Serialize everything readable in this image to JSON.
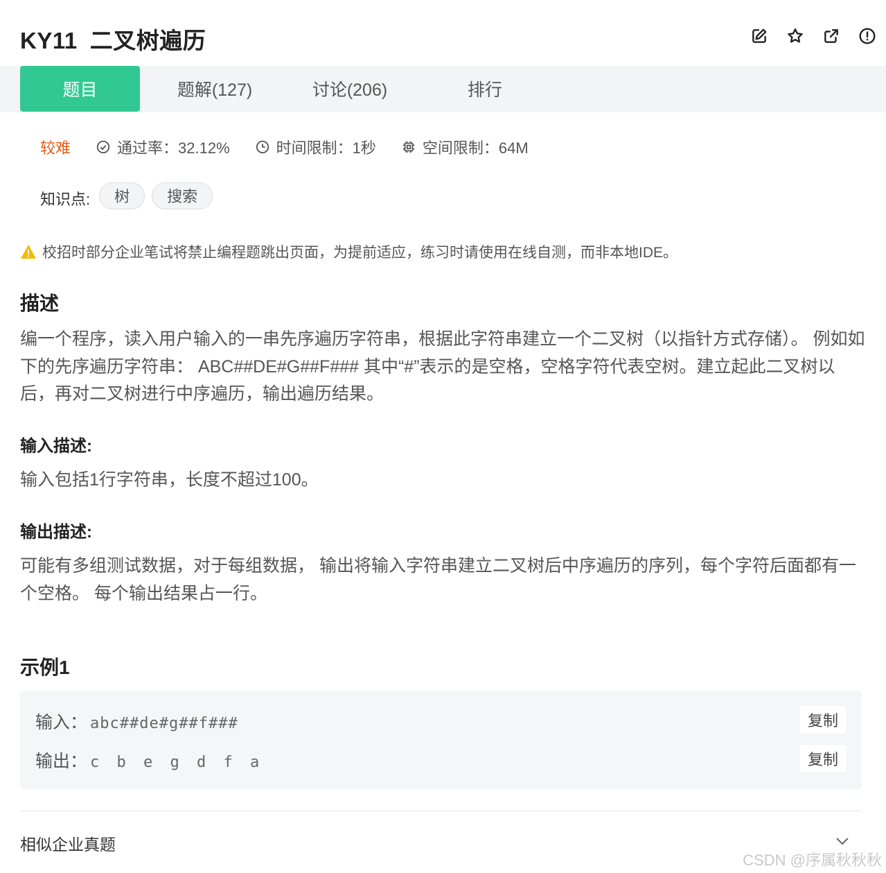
{
  "header": {
    "problem_code": "KY11",
    "problem_title": "二叉树遍历"
  },
  "header_icons": [
    "edit-icon",
    "star-icon",
    "share-icon",
    "report-icon"
  ],
  "tabs": [
    {
      "label": "题目",
      "active": true
    },
    {
      "label": "题解(127)",
      "active": false
    },
    {
      "label": "讨论(206)",
      "active": false
    },
    {
      "label": "排行",
      "active": false
    }
  ],
  "meta": {
    "difficulty": "较难",
    "pass_rate": "通过率：32.12%",
    "time_limit": "时间限制：1秒",
    "memory_limit": "空间限制：64M"
  },
  "knowledge": {
    "label": "知识点:",
    "tags": [
      "树",
      "搜索"
    ]
  },
  "warning": "校招时部分企业笔试将禁止编程题跳出页面，为提前适应，练习时请使用在线自测，而非本地IDE。",
  "description": {
    "title": "描述",
    "text": "编一个程序，读入用户输入的一串先序遍历字符串，根据此字符串建立一个二叉树（以指针方式存储）。 例如如下的先序遍历字符串： ABC##DE#G##F### 其中“#”表示的是空格，空格字符代表空树。建立起此二叉树以后，再对二叉树进行中序遍历，输出遍历结果。"
  },
  "input_desc": {
    "title": "输入描述:",
    "text": "输入包括1行字符串，长度不超过100。"
  },
  "output_desc": {
    "title": "输出描述:",
    "text": "可能有多组测试数据，对于每组数据， 输出将输入字符串建立二叉树后中序遍历的序列，每个字符后面都有一个空格。 每个输出结果占一行。"
  },
  "example": {
    "title": "示例1",
    "input_label": "输入：",
    "input_value": "abc##de#g##f###",
    "output_label": "输出：",
    "output_value": "c b e g d f a",
    "copy_label": "复制"
  },
  "similar": {
    "label": "相似企业真题"
  },
  "watermark": "CSDN @序属秋秋秋",
  "colors": {
    "accent": "#32c894",
    "difficulty": "#e85a13",
    "warning": "#f5b800"
  }
}
